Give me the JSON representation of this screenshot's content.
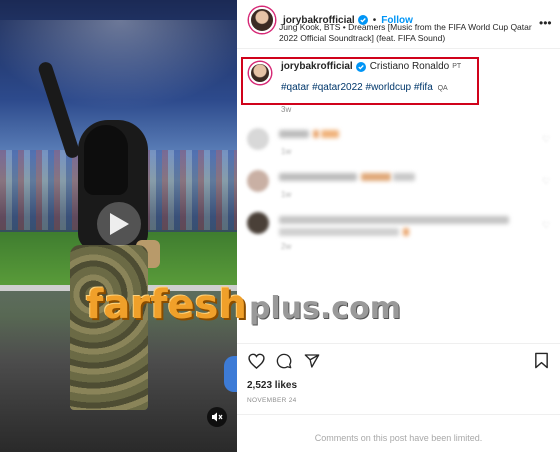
{
  "post": {
    "username": "jorybakrofficial",
    "follow_label": "Follow",
    "dot": "•",
    "more_icon": "more-horizontal-icon",
    "audio_text": "Jung Kook, BTS • Dreamers [Music from the FIFA World Cup Qatar 2022 Official Soundtrack] (feat. FIFA Sound)",
    "caption": {
      "username": "jorybakrofficial",
      "mention": "Cristiano Ronaldo",
      "mention_flag": "PT",
      "hashtags": "#qatar #qatar2022 #worldcup #fifa",
      "hashtags_flag": "QA",
      "time": "3w"
    },
    "likes": "2,523 likes",
    "date": "NOVEMBER 24",
    "comments_limited": "Comments on this post have been limited."
  },
  "watermark": {
    "main": "farfesh",
    "sub": "plus.com"
  },
  "colors": {
    "link_blue": "#0095f6",
    "hashtag_blue": "#00376b",
    "highlight_red": "#d0021b",
    "watermark_orange": "#f0a02a"
  },
  "icons": [
    "verified-badge-icon",
    "play-icon",
    "mute-icon",
    "heart-icon",
    "comment-icon",
    "share-icon",
    "bookmark-icon",
    "more-horizontal-icon"
  ]
}
